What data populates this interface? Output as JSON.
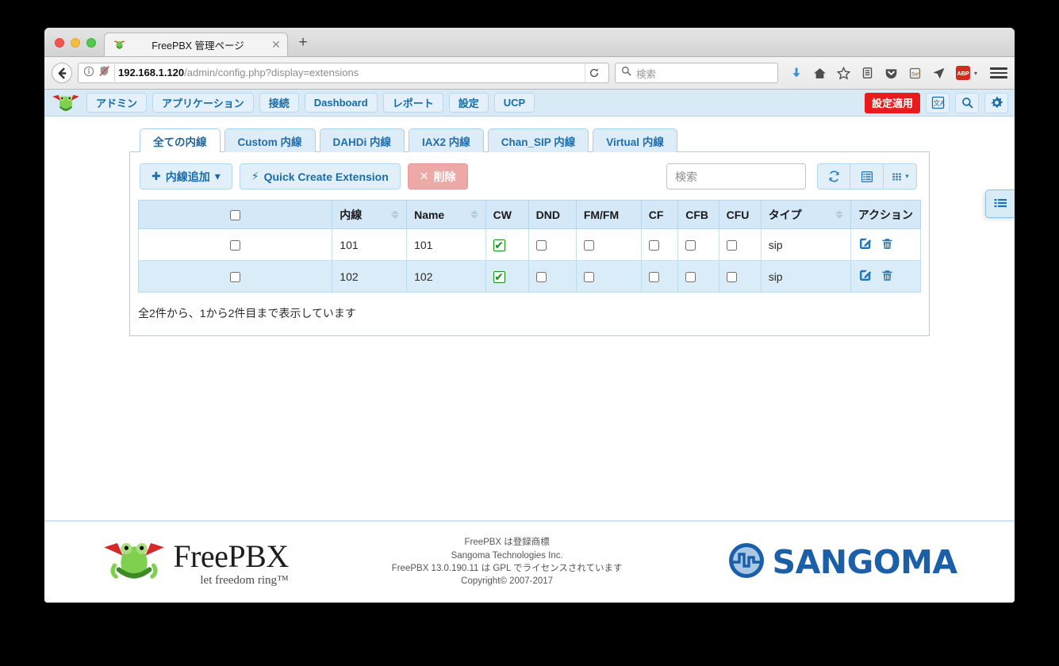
{
  "browser": {
    "tab_title": "FreePBX 管理ページ",
    "tab_close_glyph": "✕",
    "new_tab_glyph": "+",
    "url_host": "192.168.1.120",
    "url_path": "/admin/config.php?display=extensions",
    "search_placeholder": "検索",
    "icons": [
      "back-arrow-icon",
      "page-info-icon",
      "tracking-protection-off-icon",
      "reload-icon",
      "search-icon",
      "downloads-icon",
      "home-icon",
      "bookmark-star-icon",
      "library-icon",
      "pocket-icon",
      "selenium-icon",
      "send-tab-icon",
      "adblock-plus-icon",
      "hamburger-menu-icon"
    ],
    "adblock_label": "ABP"
  },
  "topnav": {
    "logo": "freepbx-frog-logo",
    "items": [
      {
        "label": "アドミン",
        "name": "nav-admin"
      },
      {
        "label": "アプリケーション",
        "name": "nav-applications"
      },
      {
        "label": "接続",
        "name": "nav-connectivity"
      },
      {
        "label": "Dashboard",
        "name": "nav-dashboard"
      },
      {
        "label": "レポート",
        "name": "nav-reports"
      },
      {
        "label": "設定",
        "name": "nav-settings"
      },
      {
        "label": "UCP",
        "name": "nav-ucp"
      }
    ],
    "apply_config_label": "設定適用",
    "apply_config_color": "#e81c1c",
    "right_icons": [
      "language-icon",
      "search-icon",
      "gear-icon"
    ]
  },
  "tabs": [
    {
      "label": "全ての内線",
      "active": true
    },
    {
      "label": "Custom 内線",
      "active": false
    },
    {
      "label": "DAHDi 内線",
      "active": false
    },
    {
      "label": "IAX2 内線",
      "active": false
    },
    {
      "label": "Chan_SIP 内線",
      "active": false
    },
    {
      "label": "Virtual 内線",
      "active": false
    }
  ],
  "toolbar": {
    "add_extension_label": "内線追加",
    "add_extension_icon": "plus-icon",
    "add_extension_caret": "▾",
    "quick_create_label": "Quick Create Extension",
    "quick_create_icon": "bolt-icon",
    "delete_label": "削除",
    "delete_icon": "times-icon",
    "search_placeholder": "検索",
    "search_value": "",
    "refresh_icon": "refresh-icon",
    "toggle_icon": "toggle-view-icon",
    "columns_icon": "columns-grid-icon",
    "columns_caret": "▾"
  },
  "table": {
    "columns": [
      {
        "label": "",
        "name": "select-all-column",
        "sortable": false
      },
      {
        "label": "内線",
        "name": "extension-column",
        "sortable": true
      },
      {
        "label": "Name",
        "name": "name-column",
        "sortable": true
      },
      {
        "label": "CW",
        "name": "cw-column",
        "sortable": false
      },
      {
        "label": "DND",
        "name": "dnd-column",
        "sortable": false
      },
      {
        "label": "FM/FM",
        "name": "fmfm-column",
        "sortable": false
      },
      {
        "label": "CF",
        "name": "cf-column",
        "sortable": false
      },
      {
        "label": "CFB",
        "name": "cfb-column",
        "sortable": false
      },
      {
        "label": "CFU",
        "name": "cfu-column",
        "sortable": false
      },
      {
        "label": "タイプ",
        "name": "type-column",
        "sortable": true
      },
      {
        "label": "アクション",
        "name": "action-column",
        "sortable": false
      }
    ],
    "rows": [
      {
        "selected": false,
        "extension": "101",
        "name": "101",
        "cw": true,
        "dnd": false,
        "fmfm": false,
        "cf": false,
        "cfb": false,
        "cfu": false,
        "type": "sip"
      },
      {
        "selected": false,
        "extension": "102",
        "name": "102",
        "cw": true,
        "dnd": false,
        "fmfm": false,
        "cf": false,
        "cfb": false,
        "cfu": false,
        "type": "sip"
      }
    ],
    "row_action_icons": [
      "edit-icon",
      "delete-icon"
    ],
    "info_text": "全2件から、1から2件目まで表示しています",
    "checked_color": "#179017"
  },
  "side_handle": {
    "icon": "list-panel-icon"
  },
  "footer": {
    "brand_name": "FreePBX",
    "brand_slogan": "let freedom ring™",
    "legal_lines": [
      "FreePBX は登録商標",
      "Sangoma Technologies Inc.",
      "FreePBX 13.0.190.11 は GPL でライセンスされています",
      "Copyright© 2007-2017"
    ],
    "sangoma_name": "SANGOMA"
  }
}
